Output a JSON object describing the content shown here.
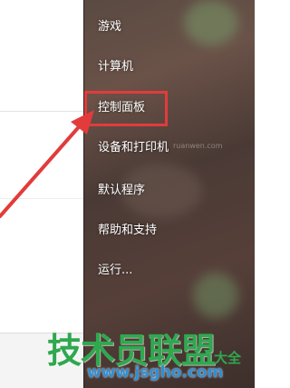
{
  "menu": {
    "items": [
      {
        "label": "游戏"
      },
      {
        "label": "计算机"
      },
      {
        "label": "控制面板"
      },
      {
        "label": "设备和打印机"
      },
      {
        "label": "默认程序"
      },
      {
        "label": "帮助和支持"
      },
      {
        "label": "运行..."
      }
    ]
  },
  "annotation": {
    "color": "#e23b3b"
  },
  "watermark": {
    "title": "技术员联盟",
    "url": "www.jsgho.com",
    "suffix": "大全",
    "small": "ruanwen.com"
  }
}
